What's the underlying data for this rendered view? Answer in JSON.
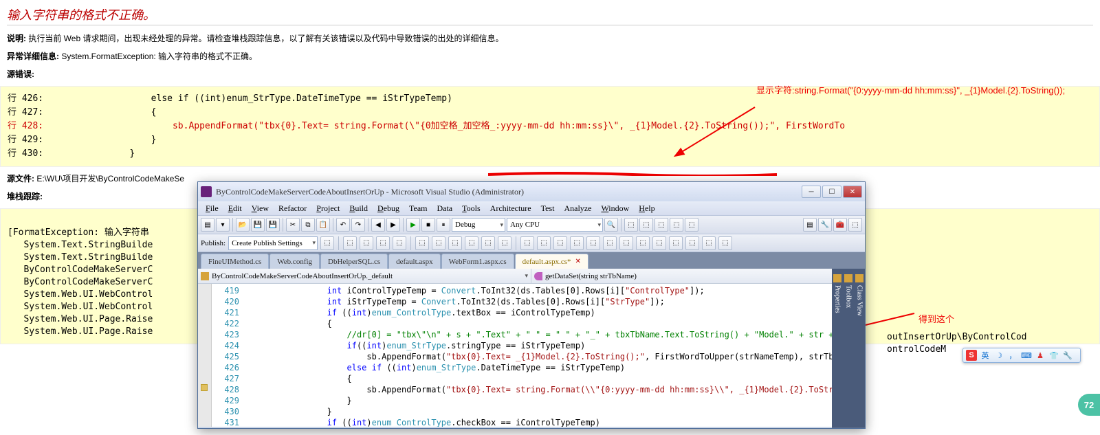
{
  "page": {
    "title": "输入字符串的格式不正确。",
    "desc_label": "说明:",
    "desc_text": " 执行当前 Web 请求期间，出现未经处理的异常。请检查堆栈跟踪信息，以了解有关该错误以及代码中导致错误的出处的详细信息。",
    "exc_label": "异常详细信息:",
    "exc_text": " System.FormatException: 输入字符串的格式不正确。",
    "src_err_label": "源错误:",
    "src_file_label": "源文件:",
    "src_file_text": " E:\\WU\\项目开发\\ByControlCodeMakeSe",
    "stack_label": "堆栈跟踪:"
  },
  "codeblock": {
    "lines": [
      {
        "num": "行 426:",
        "red": false,
        "code": "                    else if ((int)enum_StrType.DateTimeType == iStrTypeTemp)"
      },
      {
        "num": "行 427:",
        "red": false,
        "code": "                    {"
      },
      {
        "num": "行 428:",
        "red": true,
        "code": "                        sb.AppendFormat(\"tbx{0}.Text= string.Format(\\\"{0加空格_加空格_:yyyy-mm-dd hh:mm:ss}\\\", _{1}Model.{2}.ToString());\", FirstWordTo"
      },
      {
        "num": "行 429:",
        "red": false,
        "code": "                    }"
      },
      {
        "num": "行 430:",
        "red": false,
        "code": "                }"
      }
    ]
  },
  "stack": [
    "[FormatException: 输入字符串",
    "   System.Text.StringBuilde",
    "   System.Text.StringBuilde",
    "   ByControlCodeMakeServerC",
    "   ByControlCodeMakeServerC",
    "   System.Web.UI.WebControl",
    "   System.Web.UI.WebControl",
    "   System.Web.UI.Page.Raise",
    "   System.Web.UI.Page.Raise"
  ],
  "stack_right": [
    "outInsertOrUp\\ByControlCod",
    "ontrolCodeM"
  ],
  "anno": {
    "a1": "显示字符:string.Format(\"{0:yyyy-mm-dd hh:mm:ss}\", _{1}Model.{2}.ToString());",
    "a2": "得到这个"
  },
  "vs": {
    "title": "ByControlCodeMakeServerCodeAboutInsertOrUp - Microsoft Visual Studio (Administrator)",
    "menu": [
      "File",
      "Edit",
      "View",
      "Refactor",
      "Project",
      "Build",
      "Debug",
      "Team",
      "Data",
      "Tools",
      "Architecture",
      "Test",
      "Analyze",
      "Window",
      "Help"
    ],
    "menu_u": [
      "F",
      "E",
      "V",
      "",
      "P",
      "B",
      "D",
      "",
      "",
      "T",
      "",
      "",
      "",
      "W",
      "H"
    ],
    "config": "Debug",
    "platform": "Any CPU",
    "publish_label": "Publish:",
    "publish_combo": "Create Publish Settings",
    "tabs": [
      {
        "label": "FineUIMethod.cs",
        "active": false
      },
      {
        "label": "Web.config",
        "active": false
      },
      {
        "label": "DbHelperSQL.cs",
        "active": false
      },
      {
        "label": "default.aspx",
        "active": false
      },
      {
        "label": "WebForm1.aspx.cs",
        "active": false
      },
      {
        "label": "default.aspx.cs*",
        "active": true
      }
    ],
    "nav_type": "ByControlCodeMakeServerCodeAboutInsertOrUp._default",
    "nav_member": "getDataSet(string strTbName)",
    "side_tabs": [
      "Class View",
      "Toolbox",
      "Properties"
    ],
    "line_nums": [
      "419",
      "420",
      "421",
      "422",
      "423",
      "424",
      "425",
      "426",
      "427",
      "428",
      "429",
      "430",
      "431"
    ]
  },
  "badge": "72"
}
